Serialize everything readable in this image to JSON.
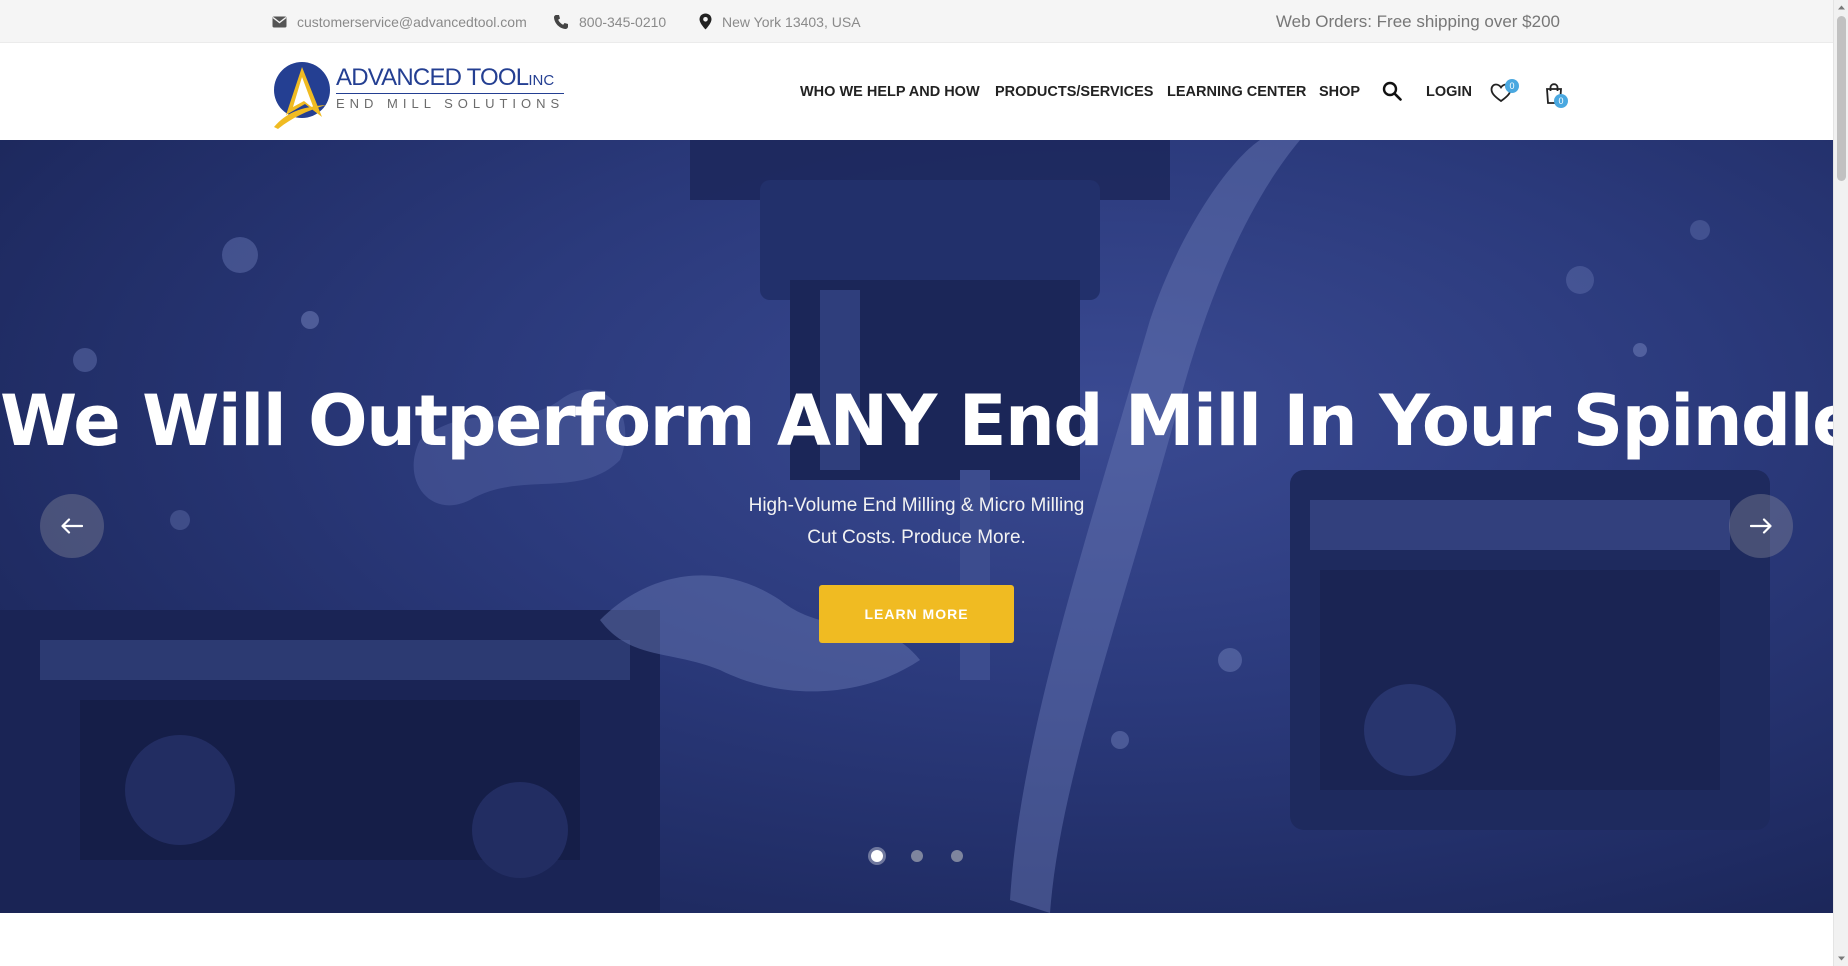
{
  "topbar": {
    "email": "customerservice@advancedtool.com",
    "phone": "800-345-0210",
    "location": "New York 13403, USA",
    "shipping_notice": "Web Orders: Free shipping over $200"
  },
  "logo": {
    "name": "ADVANCED TOOL",
    "suffix": "INC",
    "tagline": "END MILL SOLUTIONS",
    "colors": {
      "blue": "#243f92",
      "gold": "#f0bb22"
    }
  },
  "nav": {
    "items": [
      {
        "label": "WHO WE HELP AND HOW"
      },
      {
        "label": "PRODUCTS/SERVICES"
      },
      {
        "label": "LEARNING CENTER"
      },
      {
        "label": "SHOP"
      }
    ],
    "search_icon": "search-icon",
    "login_label": "LOGIN",
    "wishlist_count": "0",
    "cart_count": "0"
  },
  "hero": {
    "title": "We Will Outperform ANY End Mill In Your Spindle.",
    "subtitle_line1": "High-Volume End Milling & Micro Milling",
    "subtitle_line2": "Cut Costs. Produce More.",
    "cta_label": "LEARN MORE",
    "slide_count": 3,
    "active_slide": 1,
    "overlay_color": "#2b3a7c",
    "cta_color": "#f0bb22"
  }
}
